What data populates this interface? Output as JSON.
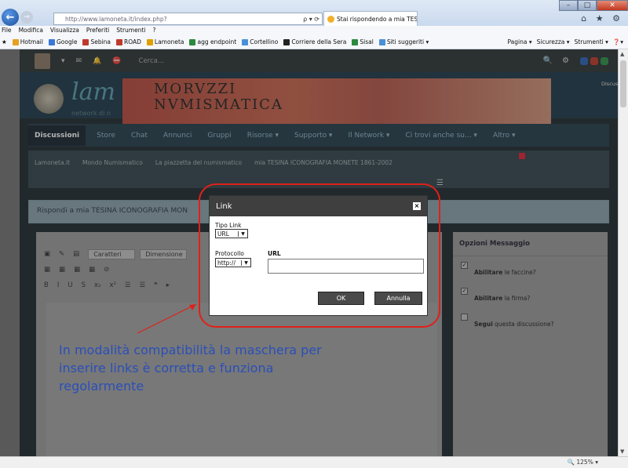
{
  "browser": {
    "address": "http://www.lamoneta.it/index.php?",
    "tab_title": "Stai rispondendo a mia TESI...",
    "tab_close": "×",
    "back_icon": "back-arrow-icon",
    "forward_icon": "forward-arrow-icon",
    "address_icons": "ρ ▾ ⟳",
    "tools_icons": "⌂ ★ ⚙",
    "win_min": "–",
    "win_max": "□",
    "win_close": "✕",
    "menus": [
      "File",
      "Modifica",
      "Visualizza",
      "Preferiti",
      "Strumenti",
      "?"
    ],
    "favorites": [
      {
        "label": "Hotmail",
        "color": "#e8a020"
      },
      {
        "label": "Google",
        "color": "#3a78d8"
      },
      {
        "label": "Sebina",
        "color": "#c0392b"
      },
      {
        "label": "ROAD",
        "color": "#c0392b"
      },
      {
        "label": "Lamoneta",
        "color": "#e0a000"
      },
      {
        "label": "agg endpoint",
        "color": "#2b8a3e"
      },
      {
        "label": "Cortellino",
        "color": "#4a90d9"
      },
      {
        "label": "Corriere della Sera",
        "color": "#222222"
      },
      {
        "label": "Sisal",
        "color": "#2b8a3e"
      },
      {
        "label": "Siti suggeriti ▾",
        "color": "#4a90d9"
      }
    ],
    "commands": [
      "Pagina ▾",
      "Sicurezza ▾",
      "Strumenti ▾",
      "❓▾"
    ],
    "zoom": "125%"
  },
  "site": {
    "search_placeholder": "Cerca...",
    "logo_text": "lam",
    "logo_sub": "network di n",
    "banner_title_line1": "MORVZZI",
    "banner_title_line2": "NVMISMATICA",
    "banner_label": "Discussioni",
    "nav_tabs": [
      "Discussioni",
      "Store",
      "Chat",
      "Annunci",
      "Gruppi",
      "Risorse ▾",
      "Supporto ▾",
      "Il Network ▾",
      "Ci trovi anche su... ▾",
      "Altro ▾"
    ],
    "breadcrumbs": [
      "Lamoneta.it",
      "Mondo Numismatico",
      "La piazzetta del numismatico",
      "mia TESINA ICONOGRAFIA MONETE 1861-2002"
    ],
    "reply_title": "Rispondi a mia TESINA ICONOGRAFIA MON"
  },
  "editor": {
    "font_select": "Caratteri",
    "size_select": "Dimensione",
    "row1_icons": [
      "▣",
      "✎",
      "▤"
    ],
    "row2_icons": [
      "▦",
      "▦",
      "▦",
      "▦",
      "⊘"
    ],
    "row3_buttons": [
      "B",
      "I",
      "U",
      "S",
      "x₂",
      "x²",
      "☰",
      "☰",
      "❝",
      "▸"
    ]
  },
  "options": {
    "title": "Opzioni Messaggio",
    "items": [
      {
        "label_bold": "Abilitare",
        "label_rest": " le faccine?",
        "checked": true
      },
      {
        "label_bold": "Abilitare",
        "label_rest": " la firma?",
        "checked": true
      },
      {
        "label_bold": "Segui",
        "label_rest": " questa discussione?",
        "checked": false
      }
    ],
    "check_mark": "✓"
  },
  "dialog": {
    "title": "Link",
    "close": "×",
    "type_label": "Tipo Link",
    "type_value": "URL",
    "protocol_label": "Protocollo",
    "protocol_value": "http://",
    "url_label": "URL",
    "url_value": "",
    "ok_label": "OK",
    "cancel_label": "Annulla",
    "select_arrow": "▼"
  },
  "annotation": {
    "text": "In modalità compatibilità la maschera per inserire links è corretta e funziona regolarmente",
    "color": "#2a4fb8",
    "frame_color": "#e0201a"
  }
}
